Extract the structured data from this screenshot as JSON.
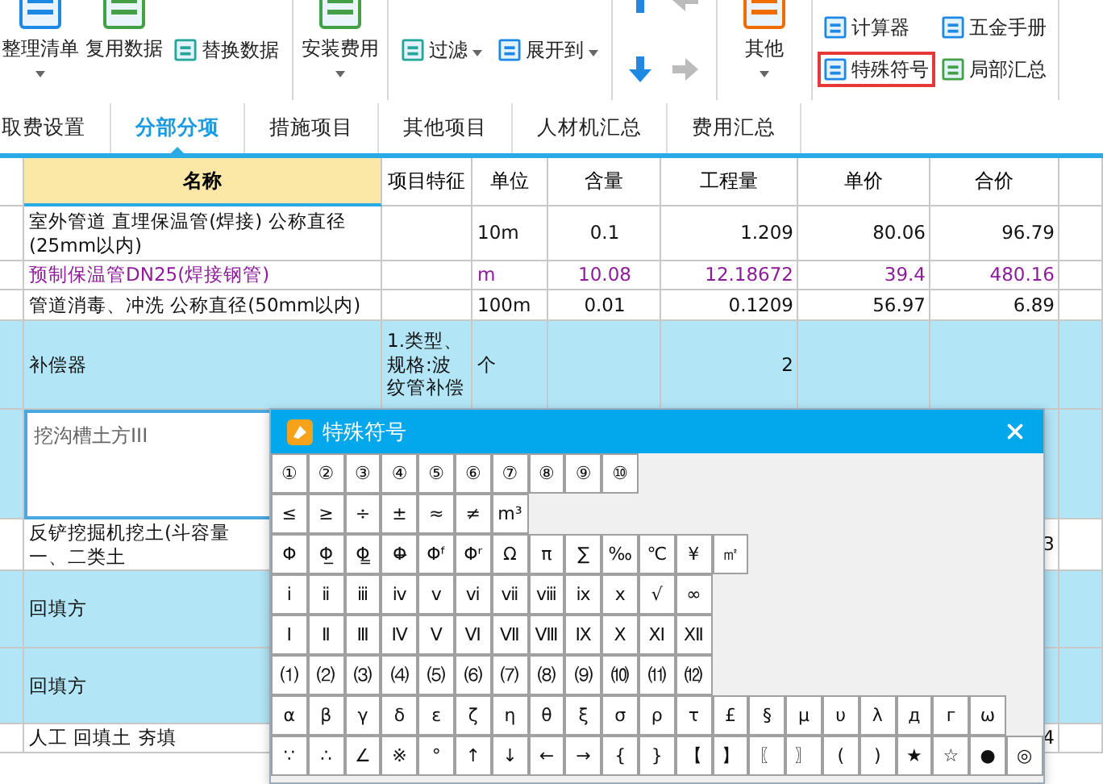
{
  "ribbon": [
    [
      {
        "kind": "large",
        "label": "整理清单",
        "caret": true
      },
      {
        "kind": "large",
        "label": "复用数据",
        "caret": false
      },
      {
        "kind": "column",
        "items": [
          {
            "label": "替换数据",
            "caret": false,
            "highlighted": false
          }
        ]
      }
    ],
    [
      {
        "kind": "large",
        "label": "安装费用",
        "caret": true
      }
    ],
    [
      {
        "kind": "column",
        "items": [
          {
            "label": "过滤",
            "caret": true,
            "highlighted": false
          }
        ]
      },
      {
        "kind": "column",
        "items": [
          {
            "label": "展开到",
            "caret": true,
            "highlighted": false
          }
        ]
      }
    ],
    [
      {
        "kind": "arrows"
      }
    ],
    [
      {
        "kind": "large",
        "label": "其他",
        "caret": true
      }
    ],
    [
      {
        "kind": "column",
        "items": [
          {
            "label": "计算器",
            "caret": false,
            "highlighted": false
          },
          {
            "label": "特殊符号",
            "caret": false,
            "highlighted": true
          }
        ]
      },
      {
        "kind": "column",
        "items": [
          {
            "label": "五金手册",
            "caret": false,
            "highlighted": false
          },
          {
            "label": "局部汇总",
            "caret": false,
            "highlighted": false
          }
        ]
      }
    ]
  ],
  "tabs": [
    {
      "label": "取费设置",
      "selected": false
    },
    {
      "label": "分部分项",
      "selected": true
    },
    {
      "label": "措施项目",
      "selected": false
    },
    {
      "label": "其他项目",
      "selected": false
    },
    {
      "label": "人材机汇总",
      "selected": false
    },
    {
      "label": "费用汇总",
      "selected": false
    }
  ],
  "table": {
    "columns": [
      "",
      "名称",
      "项目特征",
      "单位",
      "含量",
      "工程量",
      "单价",
      "合价",
      ""
    ],
    "rows": [
      {
        "kind": "normal",
        "selected": false,
        "cells": [
          "",
          "室外管道 直埋保温管(焊接) 公称直径(25mm以内)",
          "",
          "10m",
          "0.1",
          "1.209",
          "80.06",
          "96.79",
          ""
        ]
      },
      {
        "kind": "material",
        "selected": false,
        "cells": [
          "",
          "预制保温管DN25(焊接钢管)",
          "",
          "m",
          "10.08",
          "12.18672",
          "39.4",
          "480.16",
          ""
        ]
      },
      {
        "kind": "normal",
        "selected": false,
        "cells": [
          "",
          "管道消毒、冲洗 公称直径(50mm以内)",
          "",
          "100m",
          "0.01",
          "0.1209",
          "56.97",
          "6.89",
          ""
        ]
      },
      {
        "kind": "normal",
        "selected": true,
        "cells": [
          "",
          "补偿器",
          "1.类型、规格:波纹管补偿",
          "个",
          "",
          "2",
          "",
          "",
          ""
        ]
      },
      {
        "kind": "editing",
        "selected": true,
        "cells": [
          "",
          "挖沟槽土方III",
          "",
          "",
          "",
          "",
          "",
          "",
          ""
        ]
      },
      {
        "kind": "normal",
        "selected": false,
        "cells": [
          "",
          "反铲挖掘机挖土(斗容量一、二类土",
          "",
          "",
          "",
          "",
          "",
          "3",
          ""
        ]
      },
      {
        "kind": "normal",
        "selected": true,
        "cells": [
          "",
          "回填方",
          "",
          "",
          "",
          "",
          "",
          "",
          ""
        ]
      },
      {
        "kind": "normal",
        "selected": true,
        "cells": [
          "",
          "回填方",
          "",
          "",
          "",
          "",
          "",
          "",
          ""
        ]
      },
      {
        "kind": "normal",
        "selected": false,
        "cells": [
          "",
          "人工 回填土 夯填",
          "",
          "",
          "",
          "",
          "",
          "4",
          ""
        ]
      }
    ]
  },
  "dialog": {
    "title": "特殊符号",
    "rows": [
      [
        "①",
        "②",
        "③",
        "④",
        "⑤",
        "⑥",
        "⑦",
        "⑧",
        "⑨",
        "⑩"
      ],
      [
        "≤",
        "≥",
        "÷",
        "±",
        "≈",
        "≠",
        "m³"
      ],
      [
        "Φ",
        "Φ̲",
        "Φ̳",
        "Φ̶",
        "Φᶠ",
        "Φʳ",
        "Ω",
        "π",
        "∑",
        "‰",
        "℃",
        "¥",
        "㎡"
      ],
      [
        "ⅰ",
        "ⅱ",
        "ⅲ",
        "ⅳ",
        "ⅴ",
        "ⅵ",
        "ⅶ",
        "ⅷ",
        "ⅸ",
        "ⅹ",
        "√",
        "∞"
      ],
      [
        "Ⅰ",
        "Ⅱ",
        "Ⅲ",
        "Ⅳ",
        "Ⅴ",
        "Ⅵ",
        "Ⅶ",
        "Ⅷ",
        "Ⅸ",
        "Ⅹ",
        "Ⅺ",
        "Ⅻ"
      ],
      [
        "⑴",
        "⑵",
        "⑶",
        "⑷",
        "⑸",
        "⑹",
        "⑺",
        "⑻",
        "⑼",
        "⑽",
        "⑾",
        "⑿"
      ],
      [
        "α",
        "β",
        "γ",
        "δ",
        "ε",
        "ζ",
        "η",
        "θ",
        "ξ",
        "σ",
        "ρ",
        "τ",
        "£",
        "§",
        "μ",
        "υ",
        "λ",
        "д",
        "г",
        "ω"
      ],
      [
        "∵",
        "∴",
        "∠",
        "※",
        "°",
        "↑",
        "↓",
        "←",
        "→",
        "{",
        "}",
        "【",
        "】",
        "〖",
        "〗",
        "(",
        ")",
        "★",
        "☆",
        "●",
        "◎"
      ]
    ]
  }
}
